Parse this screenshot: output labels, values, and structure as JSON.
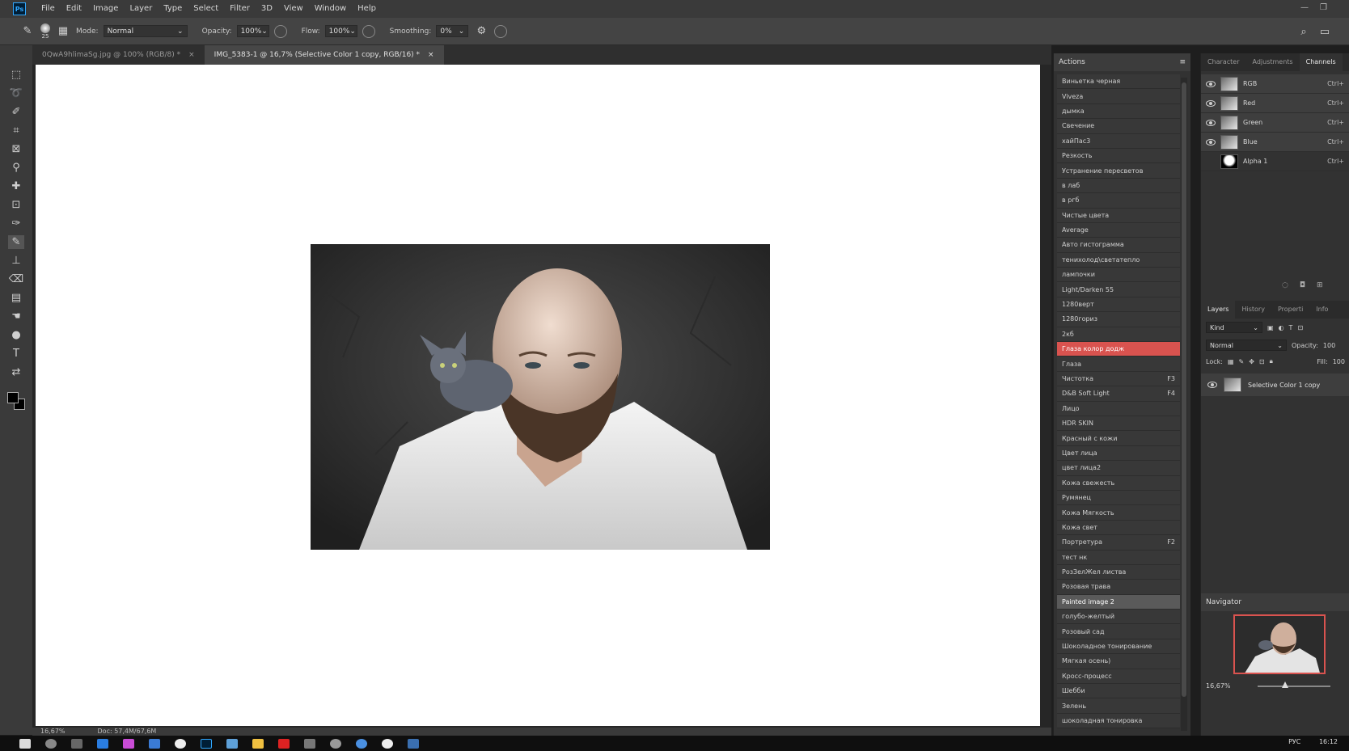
{
  "menu": [
    "File",
    "Edit",
    "Image",
    "Layer",
    "Type",
    "Select",
    "Filter",
    "3D",
    "View",
    "Window",
    "Help"
  ],
  "app_logo": "Ps",
  "options": {
    "brush_size": "25",
    "mode_label": "Mode:",
    "mode_value": "Normal",
    "opacity_label": "Opacity:",
    "opacity_value": "100%",
    "flow_label": "Flow:",
    "flow_value": "100%",
    "smoothing_label": "Smoothing:",
    "smoothing_value": "0%"
  },
  "tabs": [
    {
      "label": "0QwA9hlimaSg.jpg @ 100% (RGB/8) *"
    },
    {
      "label": "IMG_5383-1 @ 16,7% (Selective Color 1 copy, RGB/16) *"
    }
  ],
  "statusbar": {
    "zoom": "16,67%",
    "doc": "Doc: 57,4M/67,6M"
  },
  "actions": {
    "title": "Actions",
    "items": [
      {
        "label": "Виньетка черная",
        "key": ""
      },
      {
        "label": "Viveza",
        "key": ""
      },
      {
        "label": "дымка",
        "key": ""
      },
      {
        "label": "Свечение",
        "key": ""
      },
      {
        "label": "хайПас3",
        "key": ""
      },
      {
        "label": "Резкость",
        "key": ""
      },
      {
        "label": "Устранение пересветов",
        "key": ""
      },
      {
        "label": "в лаб",
        "key": ""
      },
      {
        "label": "в ргб",
        "key": ""
      },
      {
        "label": "Чистые цвета",
        "key": ""
      },
      {
        "label": "Average",
        "key": ""
      },
      {
        "label": "Авто гистограмма",
        "key": ""
      },
      {
        "label": "тенихолод\\светатепло",
        "key": ""
      },
      {
        "label": "лампочки",
        "key": ""
      },
      {
        "label": "Light/Darken 55",
        "key": ""
      },
      {
        "label": "1280верт",
        "key": ""
      },
      {
        "label": "1280гориз",
        "key": ""
      },
      {
        "label": "2кб",
        "key": ""
      },
      {
        "label": "Глаза колор додж",
        "key": "",
        "state": "red"
      },
      {
        "label": "Глаза",
        "key": ""
      },
      {
        "label": "Чистотка",
        "key": "F3"
      },
      {
        "label": "D&B Soft Light",
        "key": "F4"
      },
      {
        "label": "Лицо",
        "key": ""
      },
      {
        "label": "HDR SKIN",
        "key": ""
      },
      {
        "label": "Красный с кожи",
        "key": ""
      },
      {
        "label": "Цвет лица",
        "key": ""
      },
      {
        "label": "цвет лица2",
        "key": ""
      },
      {
        "label": "Кожа свежесть",
        "key": ""
      },
      {
        "label": "Румянец",
        "key": ""
      },
      {
        "label": "Кожа Мягкость",
        "key": ""
      },
      {
        "label": "Кожа свет",
        "key": ""
      },
      {
        "label": "Портретура",
        "key": "F2"
      },
      {
        "label": "тест нк",
        "key": ""
      },
      {
        "label": "РозЗелЖел листва",
        "key": ""
      },
      {
        "label": "Розовая трава",
        "key": ""
      },
      {
        "label": "Painted image 2",
        "key": "",
        "state": "gray"
      },
      {
        "label": "голубо-желтый",
        "key": ""
      },
      {
        "label": "Розовый сад",
        "key": ""
      },
      {
        "label": "Шоколадное тонирование",
        "key": ""
      },
      {
        "label": "Мягкая осень)",
        "key": ""
      },
      {
        "label": "Кросс-процесс",
        "key": ""
      },
      {
        "label": "Шебби",
        "key": ""
      },
      {
        "label": "Зелень",
        "key": ""
      },
      {
        "label": "шоколадная тонировка",
        "key": ""
      }
    ]
  },
  "top_tabs": [
    "Character",
    "Adjustments",
    "Channels"
  ],
  "channels": [
    {
      "name": "RGB",
      "key": "Ctrl+",
      "visible": true
    },
    {
      "name": "Red",
      "key": "Ctrl+",
      "visible": true
    },
    {
      "name": "Green",
      "key": "Ctrl+",
      "visible": true
    },
    {
      "name": "Blue",
      "key": "Ctrl+",
      "visible": true
    },
    {
      "name": "Alpha 1",
      "key": "Ctrl+",
      "visible": false
    }
  ],
  "layer_tabs": [
    "Layers",
    "History",
    "Properti",
    "Info"
  ],
  "layers": {
    "filter": "Kind",
    "blend": "Normal",
    "opacity_label": "Opacity:",
    "opacity_value": "100",
    "lock_label": "Lock:",
    "fill_label": "Fill:",
    "fill_value": "100",
    "items": [
      {
        "name": "Selective Color 1 copy"
      }
    ]
  },
  "navigator": {
    "title": "Navigator",
    "zoom": "16,67%"
  },
  "taskbar": {
    "time": "16:12",
    "lang": "РУС"
  },
  "colors": {
    "accent_red": "#d9534f",
    "selected_gray": "#5a5a5a"
  }
}
